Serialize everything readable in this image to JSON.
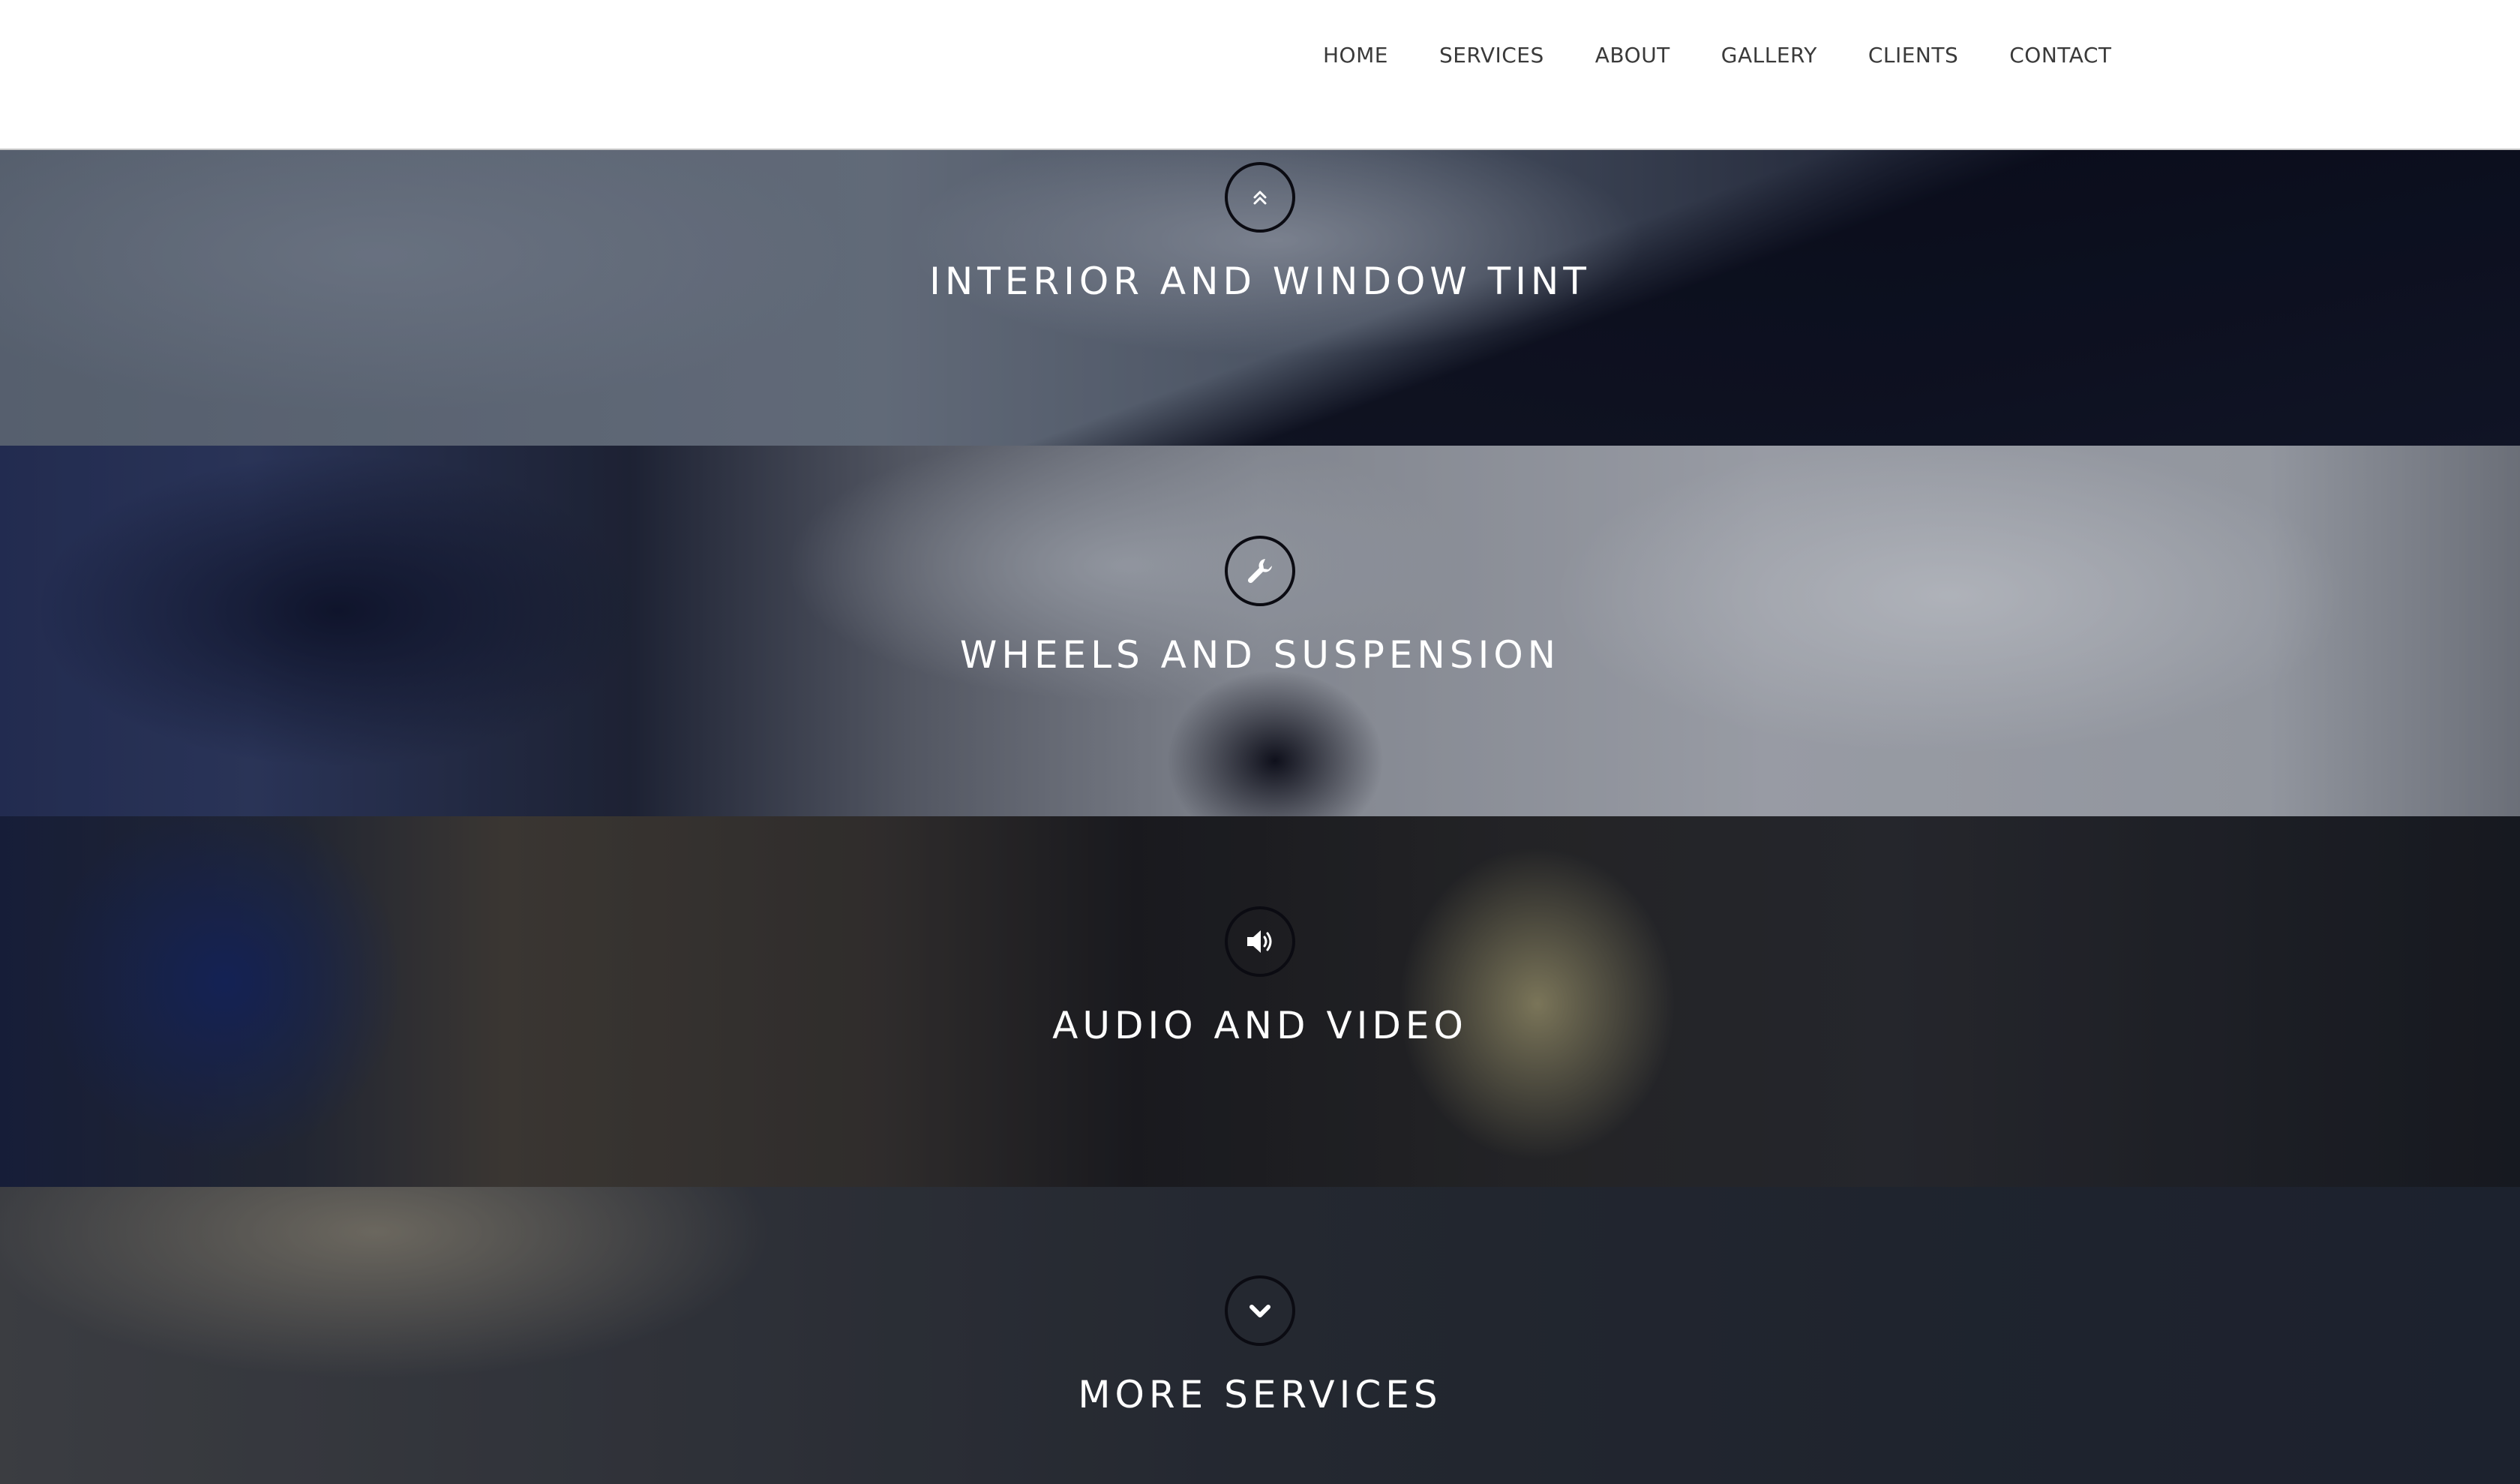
{
  "nav": {
    "items": [
      {
        "label": "HOME"
      },
      {
        "label": "SERVICES"
      },
      {
        "label": "ABOUT"
      },
      {
        "label": "GALLERY"
      },
      {
        "label": "CLIENTS"
      },
      {
        "label": "CONTACT"
      }
    ]
  },
  "services": [
    {
      "title": "INTERIOR AND WINDOW TINT",
      "icon": "double-chevron-up-icon"
    },
    {
      "title": "WHEELS AND SUSPENSION",
      "icon": "wrench-icon"
    },
    {
      "title": "AUDIO AND VIDEO",
      "icon": "speaker-icon"
    },
    {
      "title": "MORE SERVICES",
      "icon": "chevron-down-icon"
    }
  ],
  "colors": {
    "header_bg": "#ffffff",
    "nav_text": "#3a3a3a",
    "title_text": "#ffffff",
    "icon_ring": "#0b0b12"
  }
}
